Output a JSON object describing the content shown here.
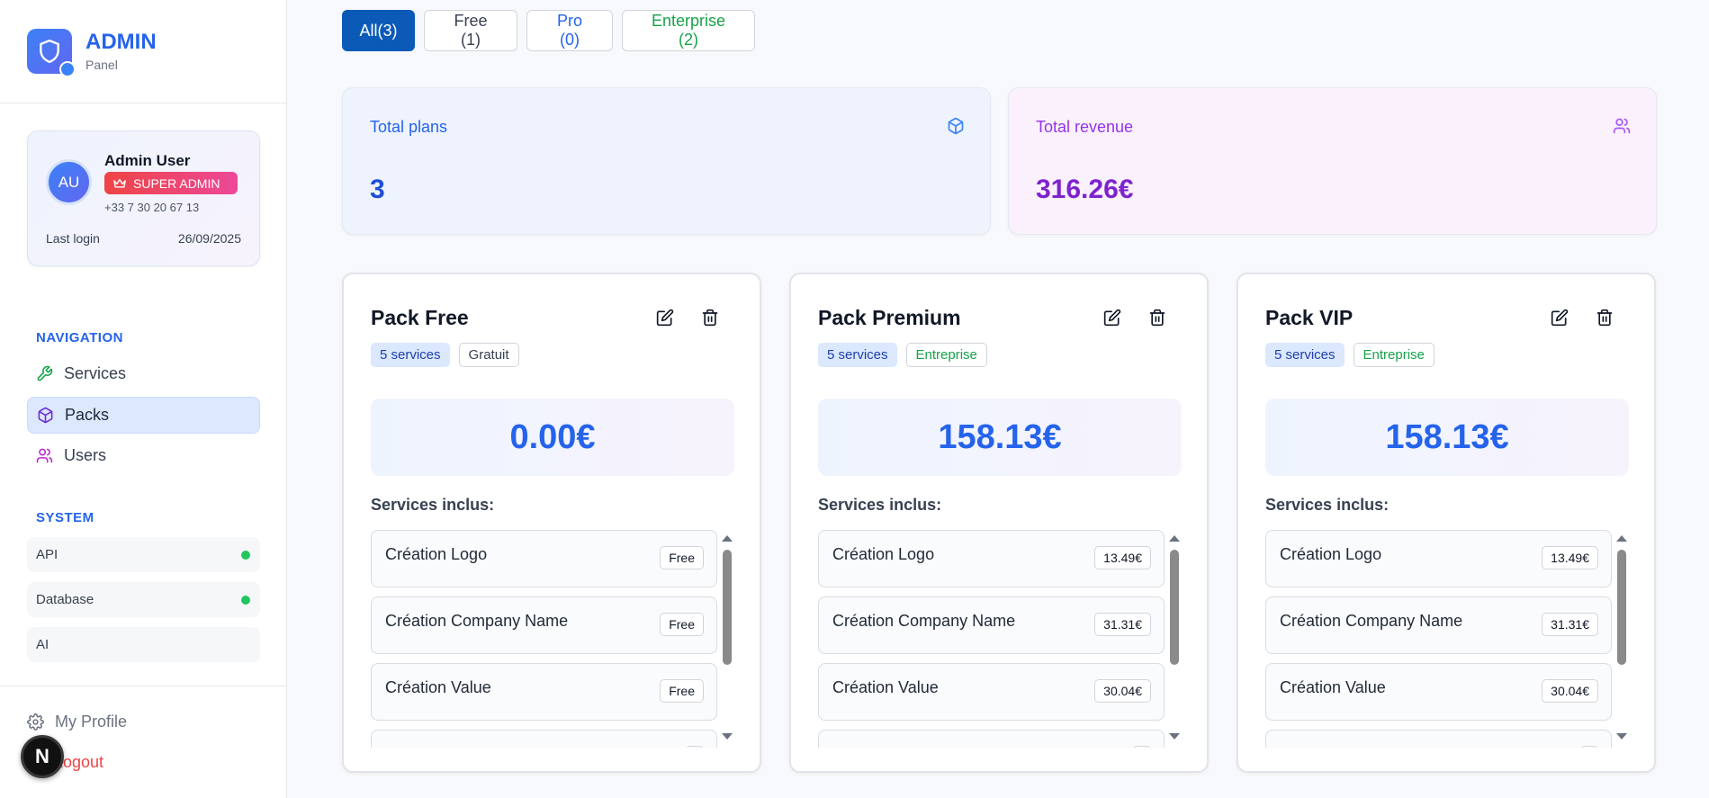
{
  "brand": {
    "title": "ADMIN",
    "subtitle": "Panel"
  },
  "user": {
    "initials": "AU",
    "name": "Admin User",
    "role": "SUPER ADMIN",
    "phone": "+33 7 30 20 67 13",
    "last_login_label": "Last login",
    "last_login_value": "26/09/2025"
  },
  "navigation": {
    "title": "NAVIGATION",
    "items": [
      {
        "label": "Services",
        "icon": "wrench-icon"
      },
      {
        "label": "Packs",
        "icon": "box-icon",
        "active": true
      },
      {
        "label": "Users",
        "icon": "users-icon"
      }
    ]
  },
  "system": {
    "title": "SYSTEM",
    "items": [
      {
        "label": "API",
        "status": "online"
      },
      {
        "label": "Database",
        "status": "online"
      },
      {
        "label": "AI",
        "status": "none"
      }
    ]
  },
  "footer": {
    "profile": "My Profile",
    "logout": "Logout",
    "next_badge": "N"
  },
  "filters": [
    {
      "label": "All(3)",
      "active": true,
      "color": "#ffffff"
    },
    {
      "label": "Free (1)",
      "color": "#374151"
    },
    {
      "label": "Pro (0)",
      "color": "#2563eb"
    },
    {
      "label": "Enterprise (2)",
      "color": "#16a34a"
    }
  ],
  "stats": [
    {
      "label": "Total plans",
      "value": "3",
      "label_color": "#2563eb",
      "value_color": "#1d4ed8",
      "icon": "box-icon"
    },
    {
      "label": "Total revenue",
      "value": "316.26€",
      "label_color": "#9333ea",
      "value_color": "#7e22ce",
      "icon": "users-icon"
    }
  ],
  "services_title": "Services inclus:",
  "packs": [
    {
      "title": "Pack Free",
      "services_badge": "5 services",
      "type": "Gratuit",
      "type_color": "#374151",
      "price": "0.00€",
      "services": [
        {
          "name": "Création Logo",
          "price": "Free"
        },
        {
          "name": "Création Company Name",
          "price": "Free"
        },
        {
          "name": "Création Value",
          "price": "Free"
        },
        {
          "name": "",
          "price": ""
        }
      ]
    },
    {
      "title": "Pack Premium",
      "services_badge": "5 services",
      "type": "Entreprise",
      "type_color": "#16a34a",
      "price": "158.13€",
      "services": [
        {
          "name": "Création Logo",
          "price": "13.49€"
        },
        {
          "name": "Création Company Name",
          "price": "31.31€"
        },
        {
          "name": "Création Value",
          "price": "30.04€"
        },
        {
          "name": "",
          "price": ""
        }
      ]
    },
    {
      "title": "Pack VIP",
      "services_badge": "5 services",
      "type": "Entreprise",
      "type_color": "#16a34a",
      "price": "158.13€",
      "services": [
        {
          "name": "Création Logo",
          "price": "13.49€"
        },
        {
          "name": "Création Company Name",
          "price": "31.31€"
        },
        {
          "name": "Création Value",
          "price": "30.04€"
        },
        {
          "name": "",
          "price": ""
        }
      ]
    }
  ]
}
